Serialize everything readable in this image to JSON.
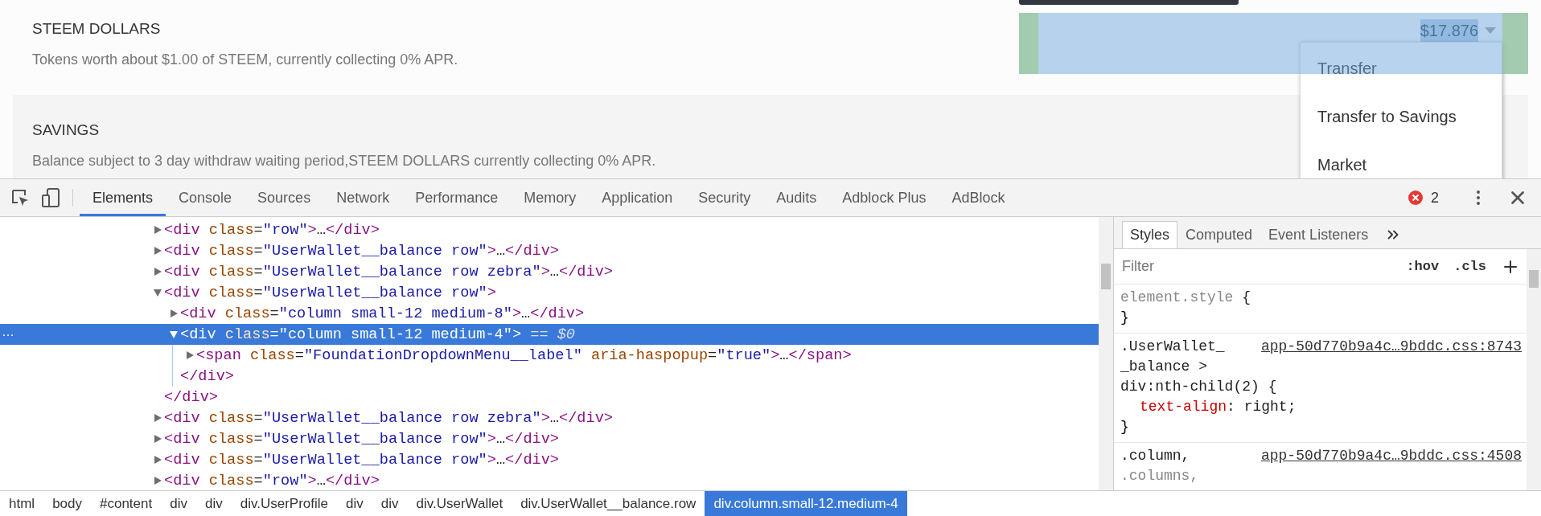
{
  "page": {
    "balances": [
      {
        "title": "STEEM DOLLARS",
        "description": "Tokens worth about $1.00 of STEEM, currently collecting 0% APR.",
        "zebra": false,
        "amount": "$17.876",
        "inspected": true,
        "menu": [
          {
            "label": "Transfer"
          },
          {
            "label": "Transfer to Savings"
          },
          {
            "label": "Market"
          }
        ]
      },
      {
        "title": "SAVINGS",
        "description": "Balance subject to 3 day withdraw waiting period,STEEM DOLLARS currently collecting 0% APR.",
        "zebra": true
      }
    ]
  },
  "devtools": {
    "tabs": [
      {
        "label": "Elements",
        "selected": true
      },
      {
        "label": "Console",
        "selected": false
      },
      {
        "label": "Sources",
        "selected": false
      },
      {
        "label": "Network",
        "selected": false
      },
      {
        "label": "Performance",
        "selected": false
      },
      {
        "label": "Memory",
        "selected": false
      },
      {
        "label": "Application",
        "selected": false
      },
      {
        "label": "Security",
        "selected": false
      },
      {
        "label": "Audits",
        "selected": false
      },
      {
        "label": "Adblock Plus",
        "selected": false
      },
      {
        "label": "AdBlock",
        "selected": false
      }
    ],
    "error_count": "2",
    "elements": {
      "nodes": [
        {
          "open": [
            {
              "kind": "tag",
              "text": "<div"
            },
            {
              "kind": "attr",
              "text": " class"
            },
            {
              "kind": "plain",
              "text": "="
            },
            {
              "kind": "value",
              "text": "\"row\""
            },
            {
              "kind": "tag",
              "text": ">"
            },
            {
              "kind": "plain",
              "text": "…"
            },
            {
              "kind": "tag",
              "text": "</div>"
            }
          ],
          "expanded": false,
          "selected": false
        },
        {
          "open": [
            {
              "kind": "tag",
              "text": "<div"
            },
            {
              "kind": "attr",
              "text": " class"
            },
            {
              "kind": "plain",
              "text": "="
            },
            {
              "kind": "value",
              "text": "\"UserWallet__balance row\""
            },
            {
              "kind": "tag",
              "text": ">"
            },
            {
              "kind": "plain",
              "text": "…"
            },
            {
              "kind": "tag",
              "text": "</div>"
            }
          ],
          "expanded": false,
          "selected": false
        },
        {
          "open": [
            {
              "kind": "tag",
              "text": "<div"
            },
            {
              "kind": "attr",
              "text": " class"
            },
            {
              "kind": "plain",
              "text": "="
            },
            {
              "kind": "value",
              "text": "\"UserWallet__balance row zebra\""
            },
            {
              "kind": "tag",
              "text": ">"
            },
            {
              "kind": "plain",
              "text": "…"
            },
            {
              "kind": "tag",
              "text": "</div>"
            }
          ],
          "expanded": false,
          "selected": false
        },
        {
          "open": [
            {
              "kind": "tag",
              "text": "<div"
            },
            {
              "kind": "attr",
              "text": " class"
            },
            {
              "kind": "plain",
              "text": "="
            },
            {
              "kind": "value",
              "text": "\"UserWallet__balance row\""
            },
            {
              "kind": "tag",
              "text": ">"
            }
          ],
          "expanded": true,
          "selected": false,
          "close": [
            {
              "kind": "tag",
              "text": "</div>"
            }
          ],
          "children": [
            {
              "open": [
                {
                  "kind": "tag",
                  "text": "<div"
                },
                {
                  "kind": "attr",
                  "text": " class"
                },
                {
                  "kind": "plain",
                  "text": "="
                },
                {
                  "kind": "value",
                  "text": "\"column small-12 medium-8\""
                },
                {
                  "kind": "tag",
                  "text": ">"
                },
                {
                  "kind": "plain",
                  "text": "…"
                },
                {
                  "kind": "tag",
                  "text": "</div>"
                }
              ],
              "expanded": false,
              "selected": false
            },
            {
              "open": [
                {
                  "kind": "tag",
                  "text": "<div"
                },
                {
                  "kind": "attr",
                  "text": " class"
                },
                {
                  "kind": "plain",
                  "text": "="
                },
                {
                  "kind": "value",
                  "text": "\"column small-12 medium-4\""
                },
                {
                  "kind": "tag",
                  "text": ">"
                },
                {
                  "kind": "hint",
                  "text": " == $0"
                }
              ],
              "gutter": "…",
              "expanded": true,
              "selected": true,
              "close": [
                {
                  "kind": "tag",
                  "text": "</div>"
                }
              ],
              "children": [
                {
                  "open": [
                    {
                      "kind": "tag",
                      "text": "<span"
                    },
                    {
                      "kind": "attr",
                      "text": " class"
                    },
                    {
                      "kind": "plain",
                      "text": "="
                    },
                    {
                      "kind": "value",
                      "text": "\"FoundationDropdownMenu__label\""
                    },
                    {
                      "kind": "attr",
                      "text": " aria-haspopup"
                    },
                    {
                      "kind": "plain",
                      "text": "="
                    },
                    {
                      "kind": "value",
                      "text": "\"true\""
                    },
                    {
                      "kind": "tag",
                      "text": ">"
                    },
                    {
                      "kind": "plain",
                      "text": "…"
                    },
                    {
                      "kind": "tag",
                      "text": "</span>"
                    }
                  ],
                  "expanded": false,
                  "selected": false
                }
              ]
            }
          ]
        },
        {
          "open": [
            {
              "kind": "tag",
              "text": "<div"
            },
            {
              "kind": "attr",
              "text": " class"
            },
            {
              "kind": "plain",
              "text": "="
            },
            {
              "kind": "value",
              "text": "\"UserWallet__balance row zebra\""
            },
            {
              "kind": "tag",
              "text": ">"
            },
            {
              "kind": "plain",
              "text": "…"
            },
            {
              "kind": "tag",
              "text": "</div>"
            }
          ],
          "expanded": false,
          "selected": false
        },
        {
          "open": [
            {
              "kind": "tag",
              "text": "<div"
            },
            {
              "kind": "attr",
              "text": " class"
            },
            {
              "kind": "plain",
              "text": "="
            },
            {
              "kind": "value",
              "text": "\"UserWallet__balance row\""
            },
            {
              "kind": "tag",
              "text": ">"
            },
            {
              "kind": "plain",
              "text": "…"
            },
            {
              "kind": "tag",
              "text": "</div>"
            }
          ],
          "expanded": false,
          "selected": false
        },
        {
          "open": [
            {
              "kind": "tag",
              "text": "<div"
            },
            {
              "kind": "attr",
              "text": " class"
            },
            {
              "kind": "plain",
              "text": "="
            },
            {
              "kind": "value",
              "text": "\"UserWallet__balance row\""
            },
            {
              "kind": "tag",
              "text": ">"
            },
            {
              "kind": "plain",
              "text": "…"
            },
            {
              "kind": "tag",
              "text": "</div>"
            }
          ],
          "expanded": false,
          "selected": false
        },
        {
          "open": [
            {
              "kind": "tag",
              "text": "<div"
            },
            {
              "kind": "attr",
              "text": " class"
            },
            {
              "kind": "plain",
              "text": "="
            },
            {
              "kind": "value",
              "text": "\"row\""
            },
            {
              "kind": "tag",
              "text": ">"
            },
            {
              "kind": "plain",
              "text": "…"
            },
            {
              "kind": "tag",
              "text": "</div>"
            }
          ],
          "expanded": false,
          "selected": false
        }
      ]
    },
    "styles": {
      "tabs": [
        {
          "label": "Styles",
          "selected": true
        },
        {
          "label": "Computed",
          "selected": false
        },
        {
          "label": "Event Listeners",
          "selected": false
        }
      ],
      "filter": {
        "placeholder": "Filter"
      },
      "toggles": [
        ":hov",
        ".cls"
      ],
      "rules": [
        {
          "lines": [
            [
              {
                "kind": "dim",
                "text": "element.style"
              },
              {
                "kind": "punct",
                "text": " {"
              }
            ]
          ],
          "closing": "}"
        },
        {
          "lines": [
            [
              {
                "kind": "sel",
                "text": ".UserWallet_"
              }
            ],
            [
              {
                "kind": "sel",
                "text": "_balance >"
              }
            ],
            [
              {
                "kind": "sel",
                "text": "div:nth-child(2)"
              },
              {
                "kind": "punct",
                "text": " {"
              }
            ]
          ],
          "source": "app-50d770b9a4c…9bddc.css:8743",
          "declarations": [
            [
              {
                "kind": "prop",
                "text": "text-align"
              },
              {
                "kind": "punct",
                "text": ": "
              },
              {
                "kind": "val",
                "text": "right"
              },
              {
                "kind": "punct",
                "text": ";"
              }
            ]
          ],
          "closing": "}"
        },
        {
          "lines": [
            [
              {
                "kind": "sel",
                "text": ".column,"
              }
            ],
            [
              {
                "kind": "dim",
                "text": ".columns,"
              }
            ]
          ],
          "source": "app-50d770b9a4c…9bddc.css:4508"
        }
      ]
    },
    "breadcrumbs": [
      {
        "label": "html",
        "selected": false
      },
      {
        "label": "body",
        "selected": false
      },
      {
        "label": "#content",
        "selected": false
      },
      {
        "label": "div",
        "selected": false
      },
      {
        "label": "div",
        "selected": false
      },
      {
        "label": "div.UserProfile",
        "selected": false
      },
      {
        "label": "div",
        "selected": false
      },
      {
        "label": "div",
        "selected": false
      },
      {
        "label": "div.UserWallet",
        "selected": false
      },
      {
        "label": "div.UserWallet__balance.row",
        "selected": false
      },
      {
        "label": "div.column.small-12.medium-4",
        "selected": true
      }
    ]
  }
}
